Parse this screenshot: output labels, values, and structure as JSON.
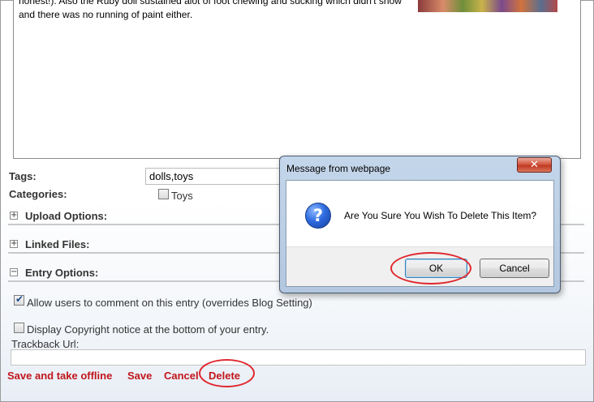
{
  "editor": {
    "line1": "honest!). Also the Ruby doll sustained alot of foot chewing and sucking which didn't show",
    "line2": "and there was no running of paint either."
  },
  "form": {
    "tags_label": "Tags:",
    "tags_value": "dolls,toys",
    "categories_label": "Categories:",
    "category_toys": "Toys"
  },
  "sections": {
    "upload": "Upload Options:",
    "linked": "Linked Files:",
    "entry": "Entry Options:",
    "plus": "+",
    "minus": "−"
  },
  "entry_options": {
    "allow_comments": "Allow users to comment on this entry (overrides Blog Setting)",
    "allow_comments_checked": true,
    "display_copyright": "Display Copyright notice at the bottom of your entry.",
    "display_copyright_checked": false,
    "trackback_label": "Trackback Url:"
  },
  "actions": {
    "save_offline": "Save and take offline",
    "save": "Save",
    "cancel": "Cancel",
    "delete": "Delete"
  },
  "dialog": {
    "title": "Message from webpage",
    "close": "✕",
    "icon": "question-icon",
    "icon_glyph": "?",
    "message": "Are You Sure You Wish To Delete This Item?",
    "ok": "OK",
    "cancel": "Cancel"
  },
  "colors": {
    "action_red": "#c0161b",
    "highlight_oval": "#e0282e"
  }
}
